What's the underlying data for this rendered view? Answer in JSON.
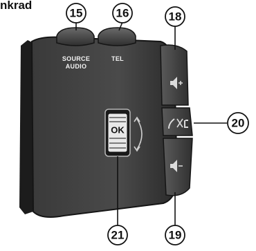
{
  "title": "nkrad",
  "callouts": {
    "c15": "15",
    "c16": "16",
    "c18": "18",
    "c19": "19",
    "c20": "20",
    "c21": "21"
  },
  "labels": {
    "source_line1": "SOURCE",
    "source_line2": "AUDIO",
    "tel": "TEL",
    "ok": "OK"
  },
  "colors": {
    "body": "#2e2e2e",
    "body_edge": "#1a1a1a",
    "buttons": "#3c3c3c",
    "callout_fill": "#ffffff"
  },
  "icons": [
    "volume-up-icon",
    "phone-mute-icon",
    "volume-down-icon"
  ]
}
